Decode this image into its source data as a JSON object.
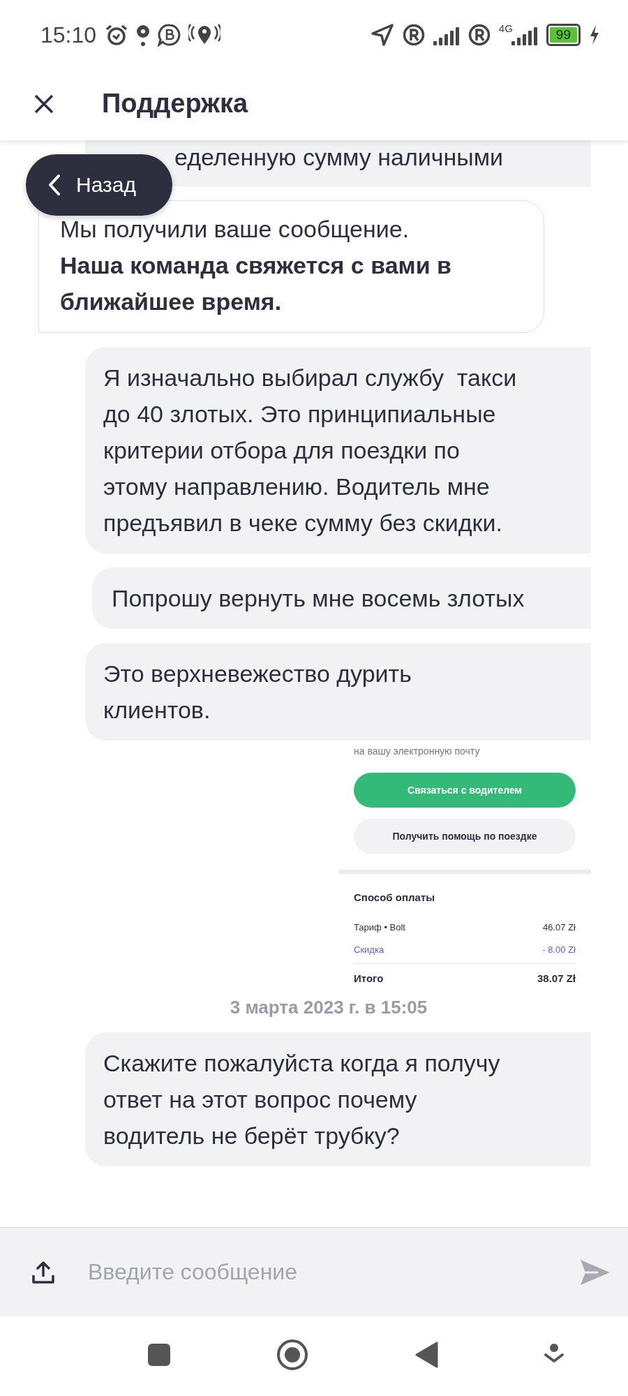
{
  "status_bar": {
    "time": "15:10",
    "network_label": "4G",
    "battery": "99"
  },
  "header": {
    "title": "Поддержка"
  },
  "back_button": {
    "label": "Назад"
  },
  "messages": [
    {
      "kind": "partial",
      "text": "еделенную сумму наличными"
    },
    {
      "kind": "support",
      "text": "Мы получили ваше сообщение.\n**Наша команда свяжется с вами в\nближайшее время.**"
    },
    {
      "kind": "user",
      "text": "Я изначально выбирал службу  такси\nдо 40 злотых. Это принципиальные\nкритерии отбора для поездки по\nэтому направлению. Водитель мне\nпредъявил в чеке сумму без скидки."
    },
    {
      "kind": "user",
      "text": "Попрошу вернуть мне восемь злотых"
    },
    {
      "kind": "user",
      "text": "Это верхневежество дурить\nклиентов."
    },
    {
      "kind": "screenshot",
      "top_text": "на вашу электронную почту",
      "primary_button": "Связаться с водителем",
      "secondary_button": "Получить помощь по поездке",
      "section_title": "Способ оплаты",
      "rows": [
        {
          "kind": "normal",
          "label": "Тариф • Bolt",
          "value": "46.07 Zł"
        },
        {
          "kind": "discount",
          "label": "Скидка",
          "value": "- 8.00 Zł"
        },
        {
          "kind": "total",
          "label": "Итого",
          "value": "38.07 Zł"
        }
      ]
    },
    {
      "kind": "timestamp",
      "text": "3 марта 2023 г. в 15:05"
    },
    {
      "kind": "user",
      "text": "Скажите пожалуйста когда я получу\nответ на этот вопрос почему\nводитель не берёт трубку?"
    }
  ],
  "composer": {
    "placeholder": "Введите сообщение"
  }
}
